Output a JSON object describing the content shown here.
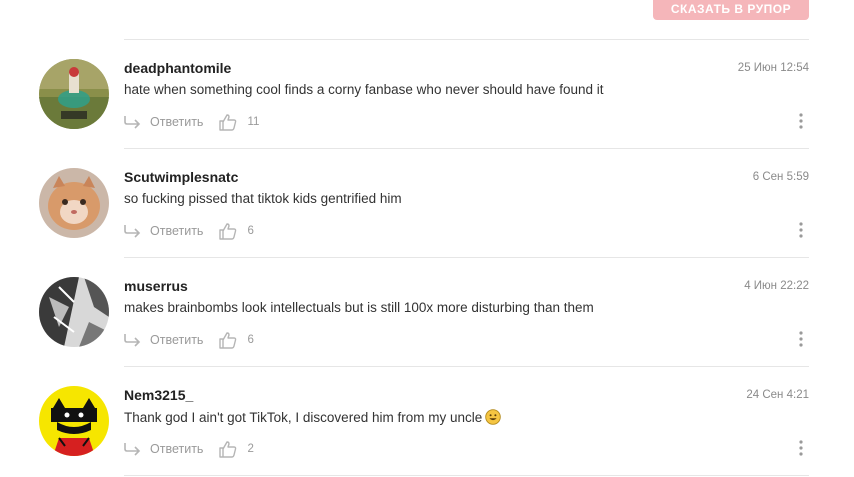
{
  "header": {
    "button_label": "СКАЗАТЬ В РУПОР"
  },
  "comments": [
    {
      "username": "deadphantomile",
      "date": "25 Июн 12:54",
      "text": "hate when something cool finds a corny fanbase who never should have found it",
      "reply_label": "Ответить",
      "likes": "11",
      "avatar": "avatar-image"
    },
    {
      "username": "Scutwimplesnatc",
      "date": "6 Сен 5:59",
      "text": "so fucking pissed that tiktok kids gentrified him",
      "reply_label": "Ответить",
      "likes": "6",
      "avatar": "avatar-image"
    },
    {
      "username": "muserrus",
      "date": "4 Июн 22:22",
      "text": "makes brainbombs look intellectuals but is still 100x more disturbing than them",
      "reply_label": "Ответить",
      "likes": "6",
      "avatar": "avatar-image"
    },
    {
      "username": "Nem3215_",
      "date": "24 Сен 4:21",
      "text": "Thank god I ain't got TikTok, I discovered him from my uncle",
      "emoji": "grinning-face-emoji",
      "reply_label": "Ответить",
      "likes": "2",
      "avatar": "avatar-image"
    }
  ],
  "colors": {
    "accent": "#f5b6ba",
    "muted": "#9a9a9a",
    "divider": "#e6e6e6"
  }
}
